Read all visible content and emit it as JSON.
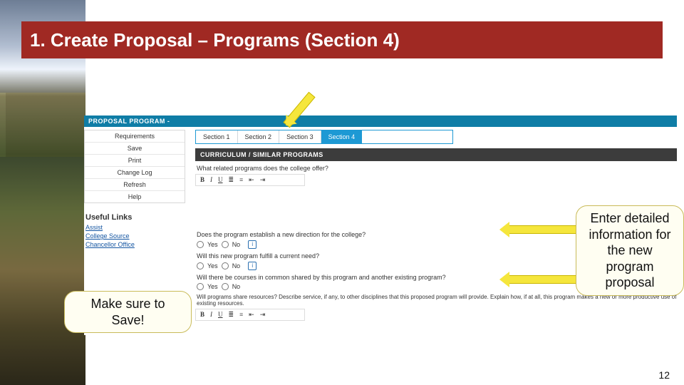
{
  "slide": {
    "title": "1. Create Proposal – Programs (Section 4)",
    "page_number": "12"
  },
  "callouts": {
    "save": "Make sure to Save!",
    "enter": "Enter detailed information for the new program proposal"
  },
  "pp": {
    "header": "PROPOSAL PROGRAM -",
    "actions": {
      "requirements": "Requirements",
      "save": "Save",
      "print": "Print",
      "change_log": "Change Log",
      "refresh": "Refresh",
      "help": "Help"
    },
    "useful_links": {
      "header": "Useful Links",
      "assist": "Assist",
      "college_source": "College Source",
      "chancellor": "Chancellor Office"
    },
    "tabs": {
      "s1": "Section 1",
      "s2": "Section 2",
      "s3": "Section 3",
      "s4": "Section 4"
    },
    "section_header": "CURRICULUM / SIMILAR PROGRAMS",
    "q_related": "What related programs does the college offer?",
    "q_direction": "Does the program establish a new direction for the college?",
    "q_need": "Will this new program fulfill a current need?",
    "q_common": "Will there be courses in common shared by this program and another existing program?",
    "q_share": "Will programs share resources? Describe service, if any, to other disciplines that this proposed program will provide. Explain how, if at all, this program makes a new or more productive use of existing resources.",
    "opt_yes": "Yes",
    "opt_no": "No",
    "toolbar": {
      "b": "B",
      "i": "I",
      "u": "U"
    }
  }
}
